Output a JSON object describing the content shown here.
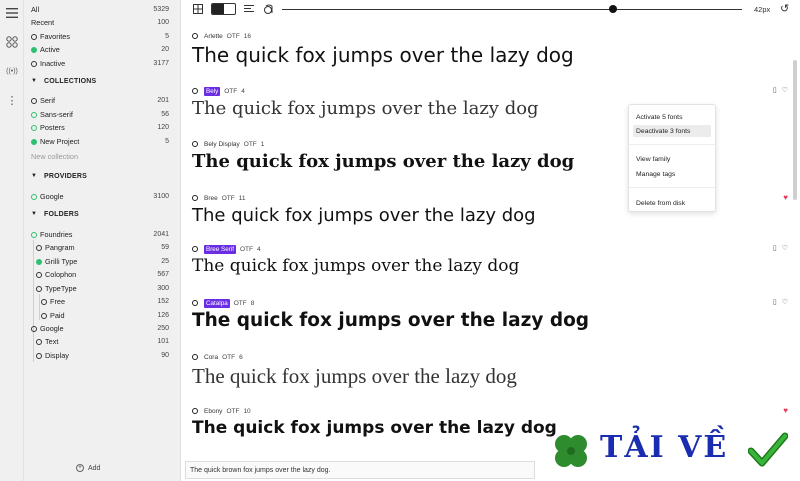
{
  "rail": {
    "icons": [
      "menu-icon",
      "grid-apps-icon",
      "broadcast-icon",
      "more-vertical-icon"
    ]
  },
  "sidebar": {
    "library": [
      {
        "label": "All",
        "count": "5329"
      },
      {
        "label": "Recent",
        "count": "100"
      },
      {
        "label": "Favorites",
        "count": "5"
      },
      {
        "label": "Active",
        "count": "20"
      },
      {
        "label": "Inactive",
        "count": "3177"
      }
    ],
    "collections_title": "COLLECTIONS",
    "collections": [
      {
        "label": "Serif",
        "count": "201"
      },
      {
        "label": "Sans-serif",
        "count": "56"
      },
      {
        "label": "Posters",
        "count": "120"
      },
      {
        "label": "New Project",
        "count": "5"
      }
    ],
    "new_collection": "New collection",
    "providers_title": "PROVIDERS",
    "providers": [
      {
        "label": "Google",
        "count": "3100"
      }
    ],
    "folders_title": "FOLDERS",
    "folders": [
      {
        "label": "Foundries",
        "count": "2041"
      },
      {
        "label": "Pangram",
        "count": "59"
      },
      {
        "label": "Grilli Type",
        "count": "25"
      },
      {
        "label": "Colophon",
        "count": "567"
      },
      {
        "label": "TypeType",
        "count": "300"
      },
      {
        "label": "Free",
        "count": "152"
      },
      {
        "label": "Paid",
        "count": "126"
      },
      {
        "label": "Google",
        "count": "250"
      },
      {
        "label": "Text",
        "count": "101"
      },
      {
        "label": "Display",
        "count": "90"
      }
    ],
    "add_label": "Add"
  },
  "toolbar": {
    "size_label": "42px",
    "slider_fraction": 0.72
  },
  "fonts": [
    {
      "name": "Arlette",
      "format": "OTF",
      "count": "16",
      "tagged": false,
      "sample": "The quick fox jumps over the lazy dog",
      "favorite": false,
      "actions": false
    },
    {
      "name": "Bely",
      "format": "OTF",
      "count": "4",
      "tagged": true,
      "sample": "The quick fox jumps over the lazy dog",
      "favorite": false,
      "actions": true
    },
    {
      "name": "Bely Display",
      "format": "OTF",
      "count": "1",
      "tagged": false,
      "sample": "The quick fox jumps over the lazy dog",
      "favorite": false,
      "actions": false
    },
    {
      "name": "Bree",
      "format": "OTF",
      "count": "11",
      "tagged": false,
      "sample": "The quick fox jumps over the lazy dog",
      "favorite": true,
      "actions": false
    },
    {
      "name": "Bree Serif",
      "format": "OTF",
      "count": "4",
      "tagged": true,
      "sample": "The quick fox jumps over the lazy dog",
      "favorite": false,
      "actions": true
    },
    {
      "name": "Catalpa",
      "format": "OTF",
      "count": "8",
      "tagged": true,
      "sample": "The quick fox jumps over the lazy dog",
      "favorite": false,
      "actions": true
    },
    {
      "name": "Cora",
      "format": "OTF",
      "count": "6",
      "tagged": false,
      "sample": "The quick fox jumps over the lazy dog",
      "favorite": false,
      "actions": false
    },
    {
      "name": "Ebony",
      "format": "OTF",
      "count": "10",
      "tagged": false,
      "sample": "The quick fox jumps over the lazy dog",
      "favorite": true,
      "actions": false
    }
  ],
  "context_menu": {
    "items": [
      "Activate 5 fonts",
      "Deactivate 3 fonts",
      "View family",
      "Manage tags",
      "Delete from disk"
    ]
  },
  "preview_text": "The quick brown fox jumps over the lazy dog.",
  "watermark": {
    "text": "TẢI VỀ"
  },
  "colors": {
    "accent": "#6a2de3",
    "active_green": "#2fbf71",
    "favorite_red": "#e33b5a",
    "watermark_blue": "#1a2db0",
    "watermark_green": "#2e8b2e"
  }
}
